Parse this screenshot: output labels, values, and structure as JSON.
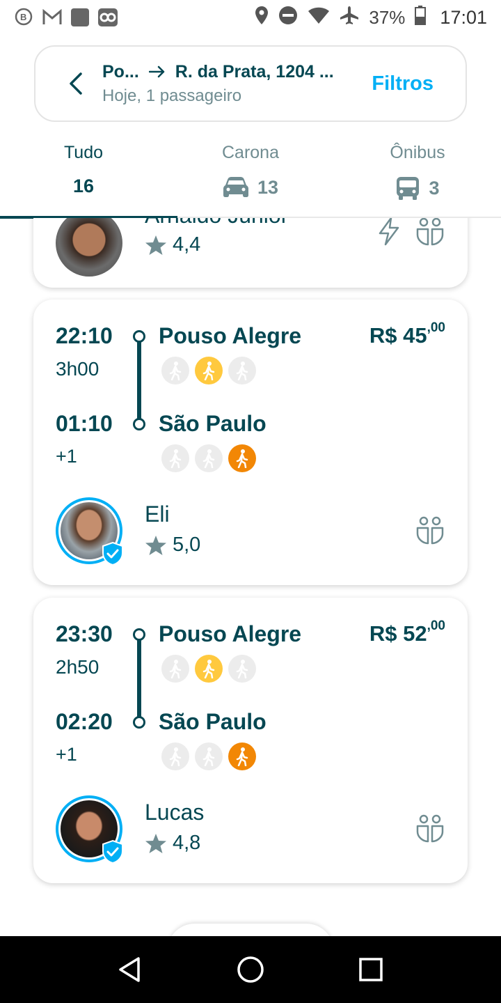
{
  "status_bar": {
    "battery": "37%",
    "time": "17:01"
  },
  "search": {
    "origin": "Po...",
    "destination": "R. da Prata, 1204 ...",
    "subtitle": "Hoje, 1 passageiro",
    "filter_label": "Filtros"
  },
  "tabs": [
    {
      "label": "Tudo",
      "count": "16",
      "icon": ""
    },
    {
      "label": "Carona",
      "count": "13",
      "icon": "car-icon"
    },
    {
      "label": "Ônibus",
      "count": "3",
      "icon": "bus-icon"
    }
  ],
  "partial_card": {
    "driver_name": "Arnaldo Junior",
    "rating": "4,4"
  },
  "trips": [
    {
      "depart_time": "22:10",
      "duration": "3h00",
      "arrive_time": "01:10",
      "next_day": "+1",
      "origin": "Pouso Alegre",
      "destination": "São Paulo",
      "price_main": "R$ 45",
      "price_cents": ",00",
      "driver_name": "Eli",
      "rating": "5,0"
    },
    {
      "depart_time": "23:30",
      "duration": "2h50",
      "arrive_time": "02:20",
      "next_day": "+1",
      "origin": "Pouso Alegre",
      "destination": "São Paulo",
      "price_main": "R$ 52",
      "price_cents": ",00",
      "driver_name": "Lucas",
      "rating": "4,8"
    }
  ],
  "colors": {
    "primary": "#054752",
    "accent": "#00aff5",
    "walk_yellow": "#ffc93e",
    "walk_orange": "#f28705"
  }
}
